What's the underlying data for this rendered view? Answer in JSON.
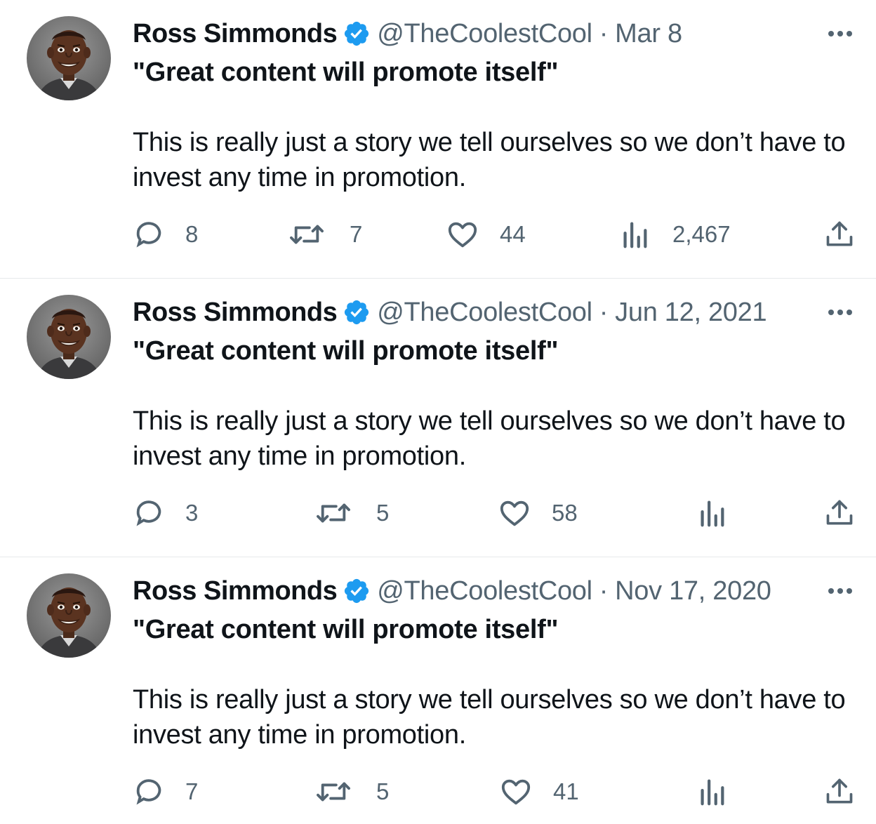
{
  "tweets": [
    {
      "author_name": "Ross Simmonds",
      "handle": "@TheCoolestCool",
      "separator": "·",
      "date": "Mar 8",
      "text_line1": "\"Great content will promote itself\"",
      "text_line2": "This is really just a story we tell ourselves so we don’t have to invest any time in promotion.",
      "replies": "8",
      "retweets": "7",
      "likes": "44",
      "views": "2,467"
    },
    {
      "author_name": "Ross Simmonds",
      "handle": "@TheCoolestCool",
      "separator": "·",
      "date": "Jun 12, 2021",
      "text_line1": "\"Great content will promote itself\"",
      "text_line2": "This is really just a story we tell ourselves so we don’t have to invest any time in promotion.",
      "replies": "3",
      "retweets": "5",
      "likes": "58",
      "views": ""
    },
    {
      "author_name": "Ross Simmonds",
      "handle": "@TheCoolestCool",
      "separator": "·",
      "date": "Nov 17, 2020",
      "text_line1": "\"Great content will promote itself\"",
      "text_line2": "This is really just a story we tell ourselves so we don’t have to invest any time in promotion.",
      "replies": "7",
      "retweets": "5",
      "likes": "41",
      "views": ""
    }
  ],
  "icons": {
    "verified": "verified-badge-icon",
    "more": "more-dots-icon",
    "reply": "reply-bubble-icon",
    "retweet": "retweet-icon",
    "like": "heart-icon",
    "views": "bar-chart-icon",
    "share": "share-upload-icon"
  },
  "colors": {
    "text_primary": "#0f1419",
    "text_secondary": "#536471",
    "verified_blue": "#1d9bf0",
    "divider": "#e6e9eb"
  }
}
